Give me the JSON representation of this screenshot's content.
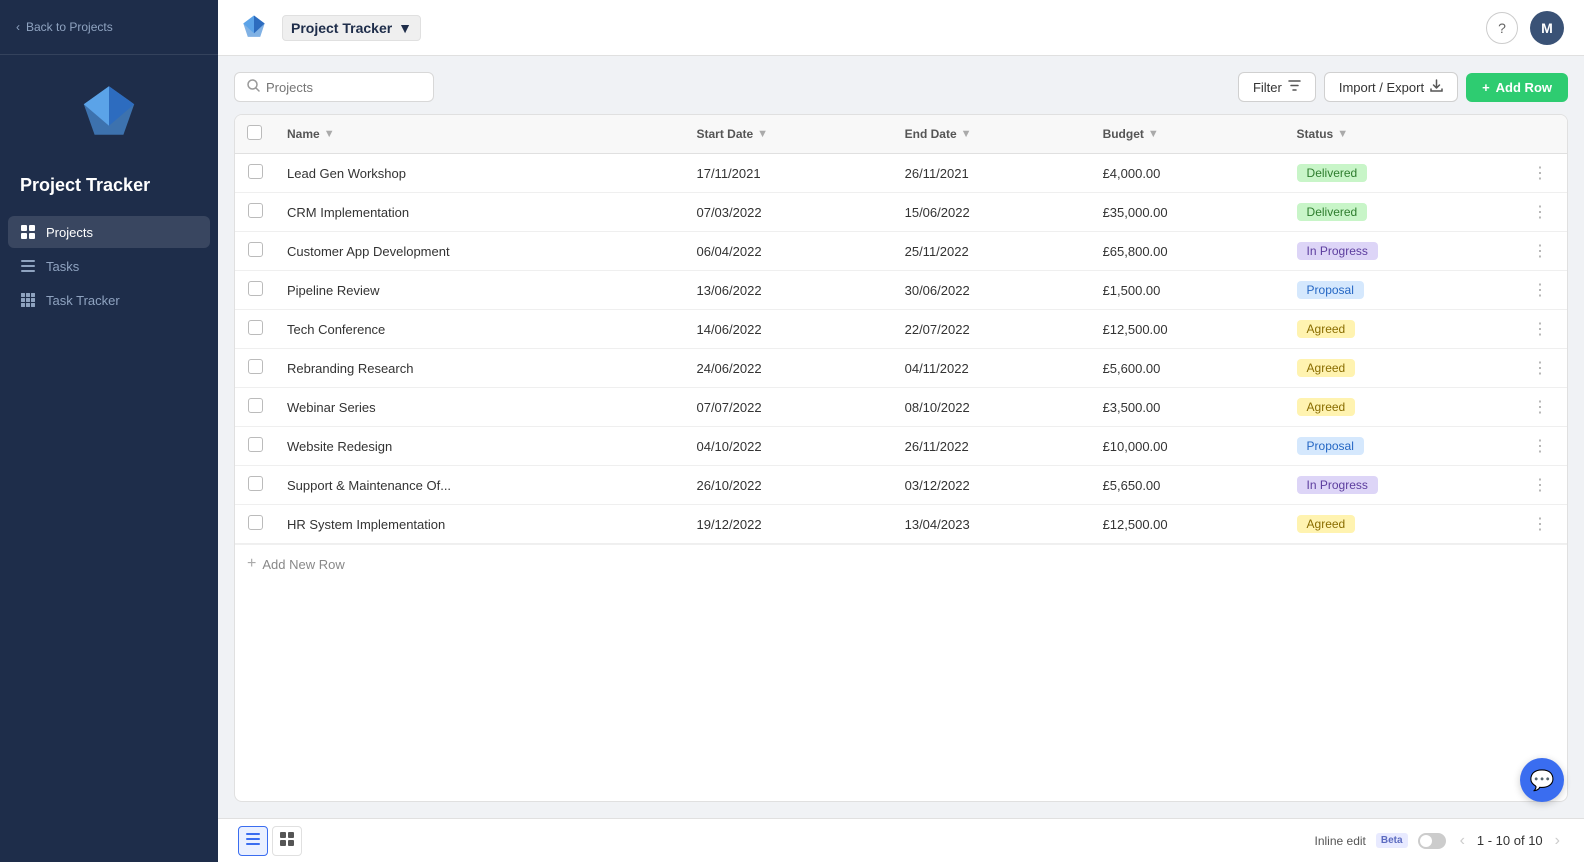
{
  "app": {
    "name": "Project Tracker",
    "back_label": "Back to Projects",
    "help_label": "?",
    "avatar_label": "M"
  },
  "sidebar": {
    "title": "Project Tracker",
    "nav": [
      {
        "id": "projects",
        "label": "Projects",
        "icon": "grid",
        "active": true
      },
      {
        "id": "tasks",
        "label": "Tasks",
        "icon": "list",
        "active": false
      },
      {
        "id": "task-tracker",
        "label": "Task Tracker",
        "icon": "grid-small",
        "active": false
      }
    ]
  },
  "toolbar": {
    "search_placeholder": "Projects",
    "filter_label": "Filter",
    "import_export_label": "Import / Export",
    "add_row_label": "Add Row"
  },
  "table": {
    "columns": [
      {
        "id": "check",
        "label": ""
      },
      {
        "id": "name",
        "label": "Name",
        "sortable": true
      },
      {
        "id": "start_date",
        "label": "Start Date",
        "sortable": true
      },
      {
        "id": "end_date",
        "label": "End Date",
        "sortable": true
      },
      {
        "id": "budget",
        "label": "Budget",
        "sortable": true
      },
      {
        "id": "status",
        "label": "Status",
        "sortable": true
      }
    ],
    "rows": [
      {
        "name": "Lead Gen Workshop",
        "start_date": "17/11/2021",
        "end_date": "26/11/2021",
        "budget": "£4,000.00",
        "status": "Delivered",
        "status_type": "delivered"
      },
      {
        "name": "CRM Implementation",
        "start_date": "07/03/2022",
        "end_date": "15/06/2022",
        "budget": "£35,000.00",
        "status": "Delivered",
        "status_type": "delivered"
      },
      {
        "name": "Customer App Development",
        "start_date": "06/04/2022",
        "end_date": "25/11/2022",
        "budget": "£65,800.00",
        "status": "In Progress",
        "status_type": "in-progress"
      },
      {
        "name": "Pipeline Review",
        "start_date": "13/06/2022",
        "end_date": "30/06/2022",
        "budget": "£1,500.00",
        "status": "Proposal",
        "status_type": "proposal"
      },
      {
        "name": "Tech Conference",
        "start_date": "14/06/2022",
        "end_date": "22/07/2022",
        "budget": "£12,500.00",
        "status": "Agreed",
        "status_type": "agreed"
      },
      {
        "name": "Rebranding Research",
        "start_date": "24/06/2022",
        "end_date": "04/11/2022",
        "budget": "£5,600.00",
        "status": "Agreed",
        "status_type": "agreed"
      },
      {
        "name": "Webinar Series",
        "start_date": "07/07/2022",
        "end_date": "08/10/2022",
        "budget": "£3,500.00",
        "status": "Agreed",
        "status_type": "agreed"
      },
      {
        "name": "Website Redesign",
        "start_date": "04/10/2022",
        "end_date": "26/11/2022",
        "budget": "£10,000.00",
        "status": "Proposal",
        "status_type": "proposal"
      },
      {
        "name": "Support & Maintenance Of...",
        "start_date": "26/10/2022",
        "end_date": "03/12/2022",
        "budget": "£5,650.00",
        "status": "In Progress",
        "status_type": "in-progress"
      },
      {
        "name": "HR System Implementation",
        "start_date": "19/12/2022",
        "end_date": "13/04/2023",
        "budget": "£12,500.00",
        "status": "Agreed",
        "status_type": "agreed"
      }
    ],
    "add_row_label": "Add New Row"
  },
  "footer": {
    "inline_edit_label": "Inline edit",
    "beta_label": "Beta",
    "pagination_label": "1 - 10 of 10"
  }
}
